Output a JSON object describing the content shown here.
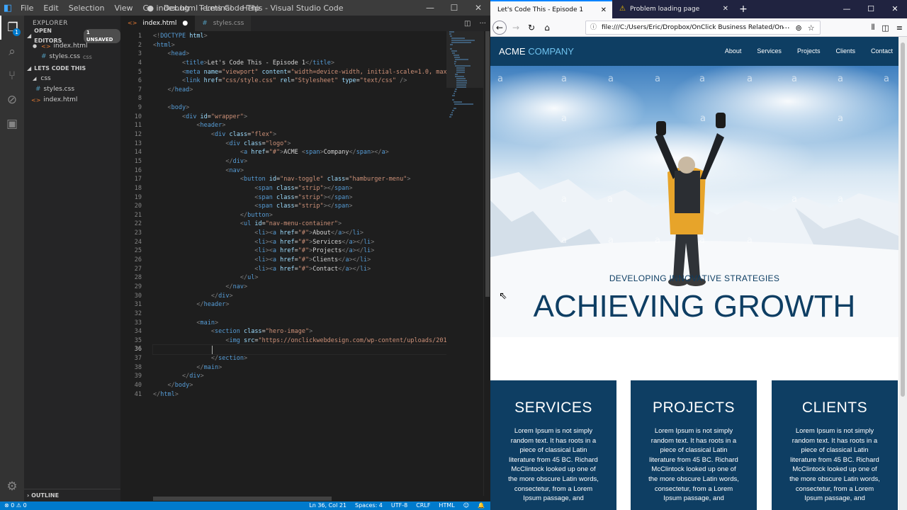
{
  "vscode": {
    "logo": "◧",
    "menu": [
      "File",
      "Edit",
      "Selection",
      "View",
      "Go",
      "Debug",
      "Terminal",
      "Help"
    ],
    "title": "● index.html - Lets Code This - Visual Studio Code",
    "activity_badge": "1",
    "explorer": {
      "header": "EXPLORER",
      "open_editors_label": "OPEN EDITORS",
      "unsaved_badge": "1 UNSAVED",
      "open_editors": [
        {
          "name": "index.html",
          "dim": ""
        },
        {
          "name": "styles.css",
          "dim": "css"
        }
      ],
      "project_label": "LETS CODE THIS",
      "folder": "css",
      "files": [
        {
          "name": "styles.css"
        },
        {
          "name": "index.html"
        }
      ],
      "outline_label": "OUTLINE"
    },
    "tabs": [
      {
        "label": "index.html",
        "active": true,
        "modified": true
      },
      {
        "label": "styles.css",
        "active": false,
        "modified": false
      }
    ],
    "current_line": 36,
    "code_lines": [
      [
        [
          "p",
          "<!"
        ],
        [
          "t",
          "DOCTYPE"
        ],
        [
          "a",
          " html"
        ],
        [
          "p",
          ">"
        ]
      ],
      [
        [
          "p",
          "<"
        ],
        [
          "t",
          "html"
        ],
        [
          "p",
          ">"
        ]
      ],
      [
        [
          "x",
          "    "
        ],
        [
          "p",
          "<"
        ],
        [
          "t",
          "head"
        ],
        [
          "p",
          ">"
        ]
      ],
      [
        [
          "x",
          "        "
        ],
        [
          "p",
          "<"
        ],
        [
          "t",
          "title"
        ],
        [
          "p",
          ">"
        ],
        [
          "x",
          "Let's Code This - Episode 1"
        ],
        [
          "p",
          "</"
        ],
        [
          "t",
          "title"
        ],
        [
          "p",
          ">"
        ]
      ],
      [
        [
          "x",
          "        "
        ],
        [
          "p",
          "<"
        ],
        [
          "t",
          "meta"
        ],
        [
          "a",
          " name"
        ],
        [
          "x",
          "="
        ],
        [
          "s",
          "\"viewport\""
        ],
        [
          "a",
          " content"
        ],
        [
          "x",
          "="
        ],
        [
          "s",
          "\"width=device-width, initial-scale=1.0, max"
        ]
      ],
      [
        [
          "x",
          "        "
        ],
        [
          "p",
          "<"
        ],
        [
          "t",
          "link"
        ],
        [
          "a",
          " href"
        ],
        [
          "x",
          "="
        ],
        [
          "s",
          "\"css/style.css\""
        ],
        [
          "a",
          " rel"
        ],
        [
          "x",
          "="
        ],
        [
          "s",
          "\"Stylesheet\""
        ],
        [
          "a",
          " type"
        ],
        [
          "x",
          "="
        ],
        [
          "s",
          "\"text/css\""
        ],
        [
          "p",
          " />"
        ]
      ],
      [
        [
          "x",
          "    "
        ],
        [
          "p",
          "</"
        ],
        [
          "t",
          "head"
        ],
        [
          "p",
          ">"
        ]
      ],
      [],
      [
        [
          "x",
          "    "
        ],
        [
          "p",
          "<"
        ],
        [
          "t",
          "body"
        ],
        [
          "p",
          ">"
        ]
      ],
      [
        [
          "x",
          "        "
        ],
        [
          "p",
          "<"
        ],
        [
          "t",
          "div"
        ],
        [
          "a",
          " id"
        ],
        [
          "x",
          "="
        ],
        [
          "s",
          "\"wrapper\""
        ],
        [
          "p",
          ">"
        ]
      ],
      [
        [
          "x",
          "            "
        ],
        [
          "p",
          "<"
        ],
        [
          "t",
          "header"
        ],
        [
          "p",
          ">"
        ]
      ],
      [
        [
          "x",
          "                "
        ],
        [
          "p",
          "<"
        ],
        [
          "t",
          "div"
        ],
        [
          "a",
          " class"
        ],
        [
          "x",
          "="
        ],
        [
          "s",
          "\"flex\""
        ],
        [
          "p",
          ">"
        ]
      ],
      [
        [
          "x",
          "                    "
        ],
        [
          "p",
          "<"
        ],
        [
          "t",
          "div"
        ],
        [
          "a",
          " class"
        ],
        [
          "x",
          "="
        ],
        [
          "s",
          "\"logo\""
        ],
        [
          "p",
          ">"
        ]
      ],
      [
        [
          "x",
          "                        "
        ],
        [
          "p",
          "<"
        ],
        [
          "t",
          "a"
        ],
        [
          "a",
          " href"
        ],
        [
          "x",
          "="
        ],
        [
          "s",
          "\"#\""
        ],
        [
          "p",
          ">"
        ],
        [
          "x",
          "ACME "
        ],
        [
          "p",
          "<"
        ],
        [
          "t",
          "span"
        ],
        [
          "p",
          ">"
        ],
        [
          "x",
          "Company"
        ],
        [
          "p",
          "</"
        ],
        [
          "t",
          "span"
        ],
        [
          "p",
          "></"
        ],
        [
          "t",
          "a"
        ],
        [
          "p",
          ">"
        ]
      ],
      [
        [
          "x",
          "                    "
        ],
        [
          "p",
          "</"
        ],
        [
          "t",
          "div"
        ],
        [
          "p",
          ">"
        ]
      ],
      [
        [
          "x",
          "                    "
        ],
        [
          "p",
          "<"
        ],
        [
          "t",
          "nav"
        ],
        [
          "p",
          ">"
        ]
      ],
      [
        [
          "x",
          "                        "
        ],
        [
          "p",
          "<"
        ],
        [
          "t",
          "button"
        ],
        [
          "a",
          " id"
        ],
        [
          "x",
          "="
        ],
        [
          "s",
          "\"nav-toggle\""
        ],
        [
          "a",
          " class"
        ],
        [
          "x",
          "="
        ],
        [
          "s",
          "\"hamburger-menu\""
        ],
        [
          "p",
          ">"
        ]
      ],
      [
        [
          "x",
          "                            "
        ],
        [
          "p",
          "<"
        ],
        [
          "t",
          "span"
        ],
        [
          "a",
          " class"
        ],
        [
          "x",
          "="
        ],
        [
          "s",
          "\"strip\""
        ],
        [
          "p",
          "></"
        ],
        [
          "t",
          "span"
        ],
        [
          "p",
          ">"
        ]
      ],
      [
        [
          "x",
          "                            "
        ],
        [
          "p",
          "<"
        ],
        [
          "t",
          "span"
        ],
        [
          "a",
          " class"
        ],
        [
          "x",
          "="
        ],
        [
          "s",
          "\"strip\""
        ],
        [
          "p",
          "></"
        ],
        [
          "t",
          "span"
        ],
        [
          "p",
          ">"
        ]
      ],
      [
        [
          "x",
          "                            "
        ],
        [
          "p",
          "<"
        ],
        [
          "t",
          "span"
        ],
        [
          "a",
          " class"
        ],
        [
          "x",
          "="
        ],
        [
          "s",
          "\"strip\""
        ],
        [
          "p",
          "></"
        ],
        [
          "t",
          "span"
        ],
        [
          "p",
          ">"
        ]
      ],
      [
        [
          "x",
          "                        "
        ],
        [
          "p",
          "</"
        ],
        [
          "t",
          "button"
        ],
        [
          "p",
          ">"
        ]
      ],
      [
        [
          "x",
          "                        "
        ],
        [
          "p",
          "<"
        ],
        [
          "t",
          "ul"
        ],
        [
          "a",
          " id"
        ],
        [
          "x",
          "="
        ],
        [
          "s",
          "\"nav-menu-container\""
        ],
        [
          "p",
          ">"
        ]
      ],
      [
        [
          "x",
          "                            "
        ],
        [
          "p",
          "<"
        ],
        [
          "t",
          "li"
        ],
        [
          "p",
          "><"
        ],
        [
          "t",
          "a"
        ],
        [
          "a",
          " href"
        ],
        [
          "x",
          "="
        ],
        [
          "s",
          "\"#\""
        ],
        [
          "p",
          ">"
        ],
        [
          "x",
          "About"
        ],
        [
          "p",
          "</"
        ],
        [
          "t",
          "a"
        ],
        [
          "p",
          "></"
        ],
        [
          "t",
          "li"
        ],
        [
          "p",
          ">"
        ]
      ],
      [
        [
          "x",
          "                            "
        ],
        [
          "p",
          "<"
        ],
        [
          "t",
          "li"
        ],
        [
          "p",
          "><"
        ],
        [
          "t",
          "a"
        ],
        [
          "a",
          " href"
        ],
        [
          "x",
          "="
        ],
        [
          "s",
          "\"#\""
        ],
        [
          "p",
          ">"
        ],
        [
          "x",
          "Services"
        ],
        [
          "p",
          "</"
        ],
        [
          "t",
          "a"
        ],
        [
          "p",
          "></"
        ],
        [
          "t",
          "li"
        ],
        [
          "p",
          ">"
        ]
      ],
      [
        [
          "x",
          "                            "
        ],
        [
          "p",
          "<"
        ],
        [
          "t",
          "li"
        ],
        [
          "p",
          "><"
        ],
        [
          "t",
          "a"
        ],
        [
          "a",
          " href"
        ],
        [
          "x",
          "="
        ],
        [
          "s",
          "\"#\""
        ],
        [
          "p",
          ">"
        ],
        [
          "x",
          "Projects"
        ],
        [
          "p",
          "</"
        ],
        [
          "t",
          "a"
        ],
        [
          "p",
          "></"
        ],
        [
          "t",
          "li"
        ],
        [
          "p",
          ">"
        ]
      ],
      [
        [
          "x",
          "                            "
        ],
        [
          "p",
          "<"
        ],
        [
          "t",
          "li"
        ],
        [
          "p",
          "><"
        ],
        [
          "t",
          "a"
        ],
        [
          "a",
          " href"
        ],
        [
          "x",
          "="
        ],
        [
          "s",
          "\"#\""
        ],
        [
          "p",
          ">"
        ],
        [
          "x",
          "Clients"
        ],
        [
          "p",
          "</"
        ],
        [
          "t",
          "a"
        ],
        [
          "p",
          "></"
        ],
        [
          "t",
          "li"
        ],
        [
          "p",
          ">"
        ]
      ],
      [
        [
          "x",
          "                            "
        ],
        [
          "p",
          "<"
        ],
        [
          "t",
          "li"
        ],
        [
          "p",
          "><"
        ],
        [
          "t",
          "a"
        ],
        [
          "a",
          " href"
        ],
        [
          "x",
          "="
        ],
        [
          "s",
          "\"#\""
        ],
        [
          "p",
          ">"
        ],
        [
          "x",
          "Contact"
        ],
        [
          "p",
          "</"
        ],
        [
          "t",
          "a"
        ],
        [
          "p",
          "></"
        ],
        [
          "t",
          "li"
        ],
        [
          "p",
          ">"
        ]
      ],
      [
        [
          "x",
          "                        "
        ],
        [
          "p",
          "</"
        ],
        [
          "t",
          "ul"
        ],
        [
          "p",
          ">"
        ]
      ],
      [
        [
          "x",
          "                    "
        ],
        [
          "p",
          "</"
        ],
        [
          "t",
          "nav"
        ],
        [
          "p",
          ">"
        ]
      ],
      [
        [
          "x",
          "                "
        ],
        [
          "p",
          "</"
        ],
        [
          "t",
          "div"
        ],
        [
          "p",
          ">"
        ]
      ],
      [
        [
          "x",
          "            "
        ],
        [
          "p",
          "</"
        ],
        [
          "t",
          "header"
        ],
        [
          "p",
          ">"
        ]
      ],
      [],
      [
        [
          "x",
          "            "
        ],
        [
          "p",
          "<"
        ],
        [
          "t",
          "main"
        ],
        [
          "p",
          ">"
        ]
      ],
      [
        [
          "x",
          "                "
        ],
        [
          "p",
          "<"
        ],
        [
          "t",
          "section"
        ],
        [
          "a",
          " class"
        ],
        [
          "x",
          "="
        ],
        [
          "s",
          "\"hero-image\""
        ],
        [
          "p",
          ">"
        ]
      ],
      [
        [
          "x",
          "                    "
        ],
        [
          "p",
          "<"
        ],
        [
          "t",
          "img"
        ],
        [
          "a",
          " src"
        ],
        [
          "x",
          "="
        ],
        [
          "s",
          "\"https://onclickwebdesign.com/wp-content/uploads/201"
        ]
      ],
      [],
      [
        [
          "x",
          "                "
        ],
        [
          "p",
          "</"
        ],
        [
          "t",
          "section"
        ],
        [
          "p",
          ">"
        ]
      ],
      [
        [
          "x",
          "            "
        ],
        [
          "p",
          "</"
        ],
        [
          "t",
          "main"
        ],
        [
          "p",
          ">"
        ]
      ],
      [
        [
          "x",
          "        "
        ],
        [
          "p",
          "</"
        ],
        [
          "t",
          "div"
        ],
        [
          "p",
          ">"
        ]
      ],
      [
        [
          "x",
          "    "
        ],
        [
          "p",
          "</"
        ],
        [
          "t",
          "body"
        ],
        [
          "p",
          ">"
        ]
      ],
      [
        [
          "p",
          "</"
        ],
        [
          "t",
          "html"
        ],
        [
          "p",
          ">"
        ]
      ]
    ],
    "status": {
      "problems": "⊗ 0  ⚠ 0",
      "position": "Ln 36, Col 21",
      "spaces": "Spaces: 4",
      "encoding": "UTF-8",
      "eol": "CRLF",
      "language": "HTML",
      "feedback_icon": "☺",
      "bell_icon": "🔔"
    }
  },
  "firefox": {
    "tabs": [
      {
        "label": "Let's Code This - Episode 1",
        "active": true
      },
      {
        "label": "Problem loading page",
        "active": false
      }
    ],
    "url": "file:///C:/Users/Eric/Dropbox/OnClick Business Related/On",
    "page": {
      "logo_main": "ACME",
      "logo_accent": "COMPANY",
      "nav": [
        "About",
        "Services",
        "Projects",
        "Clients",
        "Contact"
      ],
      "hero_subtitle": "DEVELOPING INNOVATIVE STRATEGIES",
      "hero_title": "ACHIEVING GROWTH",
      "watermark": "a",
      "cards": [
        {
          "title": "SERVICES",
          "text": "Lorem Ipsum is not simply random text. It has roots in a piece of classical Latin literature from 45 BC. Richard McClintock looked up one of the more obscure Latin words, consectetur, from a Lorem Ipsum passage, and"
        },
        {
          "title": "PROJECTS",
          "text": "Lorem Ipsum is not simply random text. It has roots in a piece of classical Latin literature from 45 BC. Richard McClintock looked up one of the more obscure Latin words, consectetur, from a Lorem Ipsum passage, and"
        },
        {
          "title": "CLIENTS",
          "text": "Lorem Ipsum is not simply random text. It has roots in a piece of classical Latin literature from 45 BC. Richard McClintock looked up one of the more obscure Latin words, consectetur, from a Lorem Ipsum passage, and"
        }
      ]
    }
  },
  "colors": {
    "vscode_accent": "#007acc",
    "site_primary": "#0e3e63",
    "site_accent": "#6fc2ee",
    "firefox_tabbar": "#202340"
  }
}
